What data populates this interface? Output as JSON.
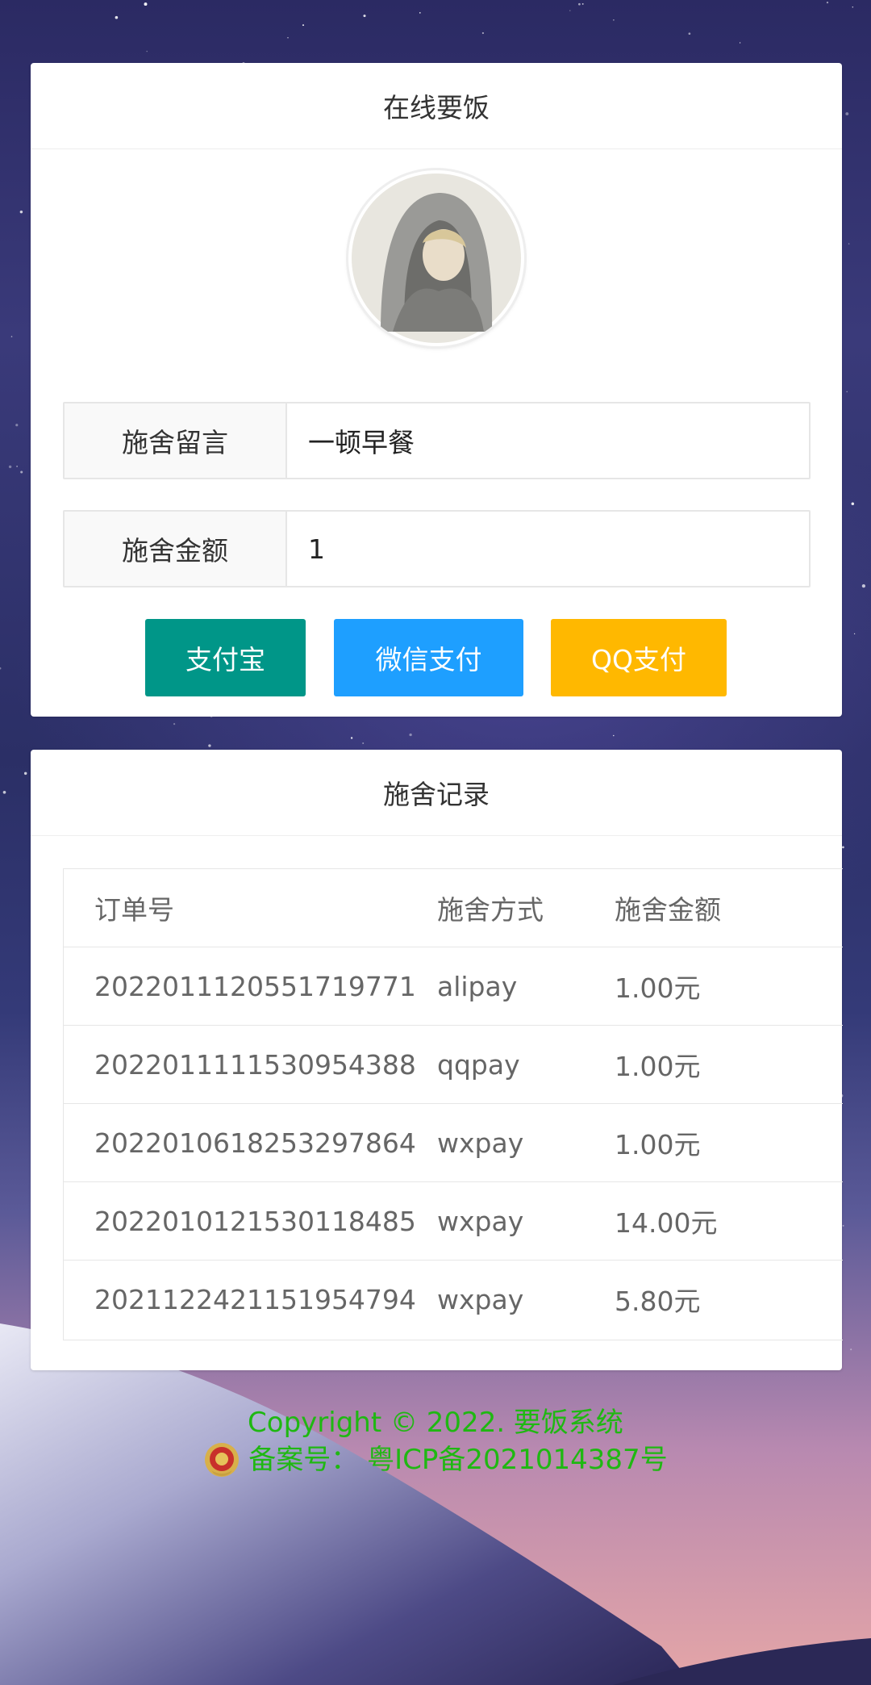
{
  "pay_card": {
    "title": "在线要饭",
    "message_label": "施舍留言",
    "message_value": "一顿早餐",
    "amount_label": "施舍金额",
    "amount_value": "1",
    "buttons": {
      "alipay": "支付宝",
      "wxpay": "微信支付",
      "qqpay": "QQ支付"
    }
  },
  "records_card": {
    "title": "施舍记录",
    "columns": [
      "订单号",
      "施舍方式",
      "施舍金额"
    ],
    "rows": [
      [
        "2022011120551719771",
        "alipay",
        "1.00元"
      ],
      [
        "2022011111530954388",
        "qqpay",
        "1.00元"
      ],
      [
        "2022010618253297864",
        "wxpay",
        "1.00元"
      ],
      [
        "2022010121530118485",
        "wxpay",
        "14.00元"
      ],
      [
        "2021122421151954794",
        "wxpay",
        "5.80元"
      ]
    ]
  },
  "footer": {
    "copyright": "Copyright © 2022. 要饭系统",
    "icp": "备案号： 粤ICP备2021014387号"
  },
  "colors": {
    "alipay": "#009688",
    "wxpay": "#1E9FFF",
    "qqpay": "#FFB800",
    "footer_text": "#1fb812"
  }
}
